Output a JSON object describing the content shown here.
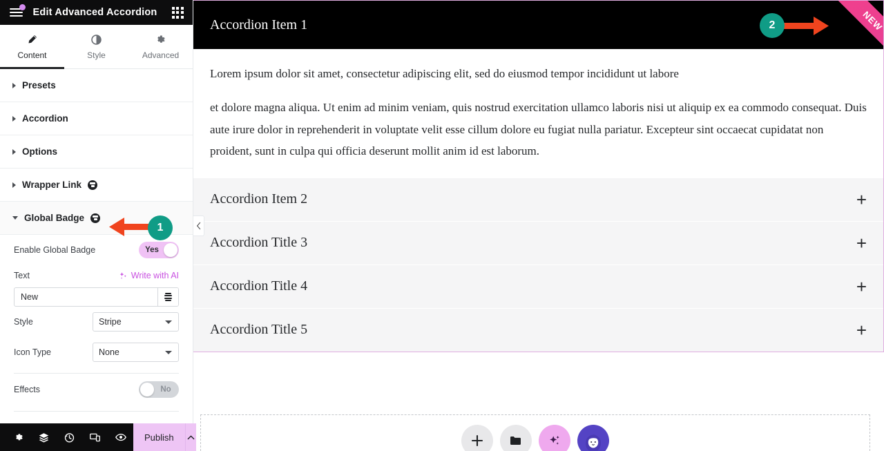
{
  "panel": {
    "header": {
      "title": "Edit Advanced Accordion",
      "menu_icon": "hamburger-icon",
      "grid_icon": "widgets-grid-icon",
      "notification_dot_color": "#d58cf0"
    },
    "tabs": [
      {
        "label": "Content",
        "icon": "pencil-icon",
        "active": true
      },
      {
        "label": "Style",
        "icon": "contrast-circle-icon",
        "active": false
      },
      {
        "label": "Advanced",
        "icon": "gear-icon",
        "active": false
      }
    ],
    "sections": [
      {
        "label": "Presets",
        "open": false,
        "pro": false
      },
      {
        "label": "Accordion",
        "open": false,
        "pro": false
      },
      {
        "label": "Options",
        "open": false,
        "pro": false
      },
      {
        "label": "Wrapper Link",
        "open": false,
        "pro": true
      },
      {
        "label": "Global Badge",
        "open": true,
        "pro": true
      }
    ],
    "controls": {
      "enable_global_badge": {
        "label": "Enable Global Badge",
        "value": "Yes",
        "on": true
      },
      "text": {
        "label": "Text",
        "ai_link": "Write with AI",
        "ai_icon": "sparkle-icon",
        "value": "New",
        "placeholder": "",
        "dynamic_icon": "dynamic-tags-icon"
      },
      "style": {
        "label": "Style",
        "value": "Stripe"
      },
      "icon_type": {
        "label": "Icon Type",
        "value": "None"
      },
      "effects": {
        "label": "Effects",
        "value": "No",
        "on": false
      }
    },
    "footer": {
      "icons": [
        {
          "name": "settings-gear-icon"
        },
        {
          "name": "navigator-layers-icon"
        },
        {
          "name": "history-clock-icon"
        },
        {
          "name": "responsive-devices-icon"
        },
        {
          "name": "preview-eye-icon"
        }
      ],
      "publish_label": "Publish",
      "publish_caret_icon": "chevron-up-icon",
      "publish_bg": "#eec5f5"
    },
    "collapse_handle_icon": "chevron-left-icon"
  },
  "canvas": {
    "accordion": {
      "items": [
        {
          "title": "Accordion Item 1",
          "expanded": true,
          "toggle_icon": "",
          "body_paragraphs": [
            "Lorem ipsum dolor sit amet, consectetur adipiscing elit, sed do eiusmod tempor incididunt ut labore",
            "et dolore magna aliqua. Ut enim ad minim veniam, quis nostrud exercitation ullamco laboris nisi ut aliquip ex ea commodo consequat. Duis aute irure dolor in reprehenderit in voluptate velit esse cillum dolore eu fugiat nulla pariatur. Excepteur sint occaecat cupidatat non proident, sunt in culpa qui officia deserunt mollit anim id est laborum."
          ]
        },
        {
          "title": "Accordion Item 2",
          "expanded": false,
          "toggle_icon": "+"
        },
        {
          "title": "Accordion Title 3",
          "expanded": false,
          "toggle_icon": "+"
        },
        {
          "title": "Accordion Title 4",
          "expanded": false,
          "toggle_icon": "+"
        },
        {
          "title": "Accordion Title 5",
          "expanded": false,
          "toggle_icon": "+"
        }
      ],
      "badge": {
        "text": "NEW",
        "style": "Stripe",
        "color": "#ee3f8f"
      }
    },
    "fabs": [
      {
        "name": "add-element-button",
        "icon": "plus-icon",
        "color": "#e8e8ea"
      },
      {
        "name": "folder-templates-button",
        "icon": "folder-icon",
        "color": "#e8e8ea"
      },
      {
        "name": "ai-button",
        "icon": "sparkle-icon",
        "color": "#efa9ee"
      },
      {
        "name": "avatar-button",
        "icon": "avatar-icon",
        "color": "#5443c4"
      }
    ]
  },
  "annotations": [
    {
      "number": "1",
      "arrow": "left",
      "color": "#109c86",
      "arrow_color": "#f0441e"
    },
    {
      "number": "2",
      "arrow": "right",
      "color": "#109c86",
      "arrow_color": "#f0441e"
    }
  ]
}
